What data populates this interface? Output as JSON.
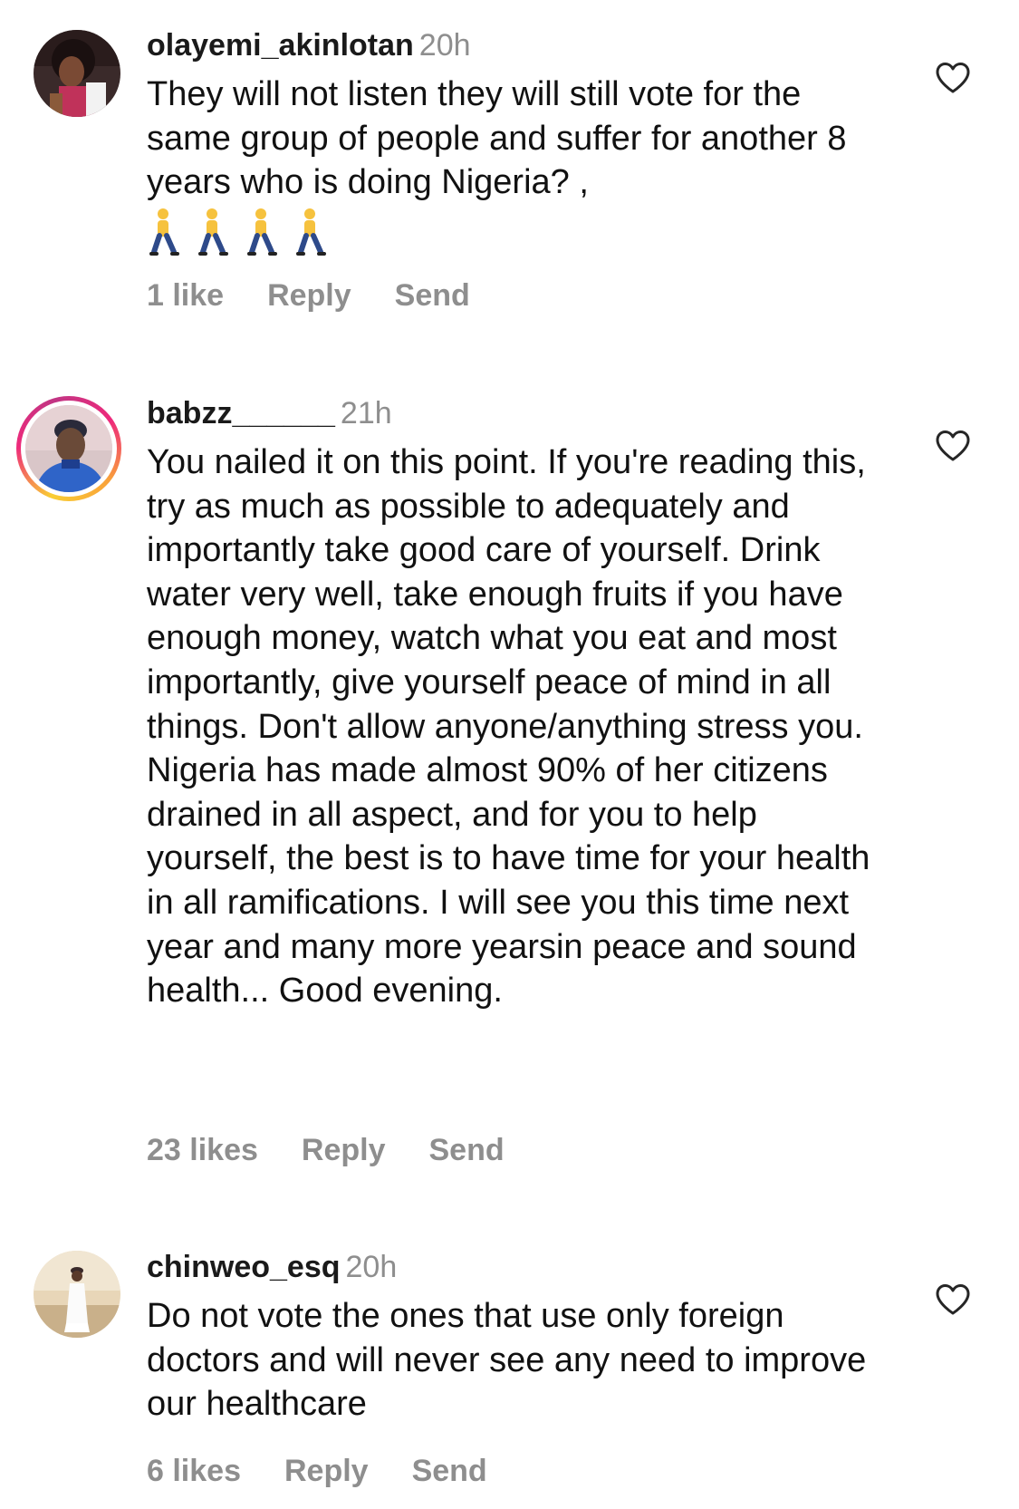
{
  "comments": [
    {
      "username": "olayemi_akinlotan",
      "time": "20h",
      "text": "They will not listen they will still vote for the same group of people and suffer for another 8 years who is doing Nigeria? ,",
      "emoji_icon": "person-walking-icon",
      "likes": "1 like",
      "reply": "Reply",
      "send": "Send"
    },
    {
      "username": "babzz______",
      "time": "21h",
      "text": "You nailed it on this point. If you're reading this, try as much as possible to adequately and importantly take good care of yourself. Drink water very well, take enough fruits if you have enough money, watch what you eat and most importantly, give yourself peace of mind in all things. Don't allow anyone/anything stress you. Nigeria has made almost 90% of her citizens drained in all aspect, and for you to help yourself, the best is to have time for your health in all ramifications. I will see you this time next year and many more yearsin peace and sound health... Good evening.",
      "likes": "23 likes",
      "reply": "Reply",
      "send": "Send"
    },
    {
      "username": "chinweo_esq",
      "time": "20h",
      "text": "Do not vote the ones that use only foreign doctors and will never see any need to improve our healthcare",
      "likes": "6 likes",
      "reply": "Reply",
      "send": "Send"
    }
  ],
  "colors": {
    "text": "#111111",
    "muted": "#8e8e8e",
    "story_ring_start": "#f9ce34",
    "story_ring_mid": "#ee2a7b"
  },
  "icons": {
    "like": "heart-outline-icon"
  }
}
